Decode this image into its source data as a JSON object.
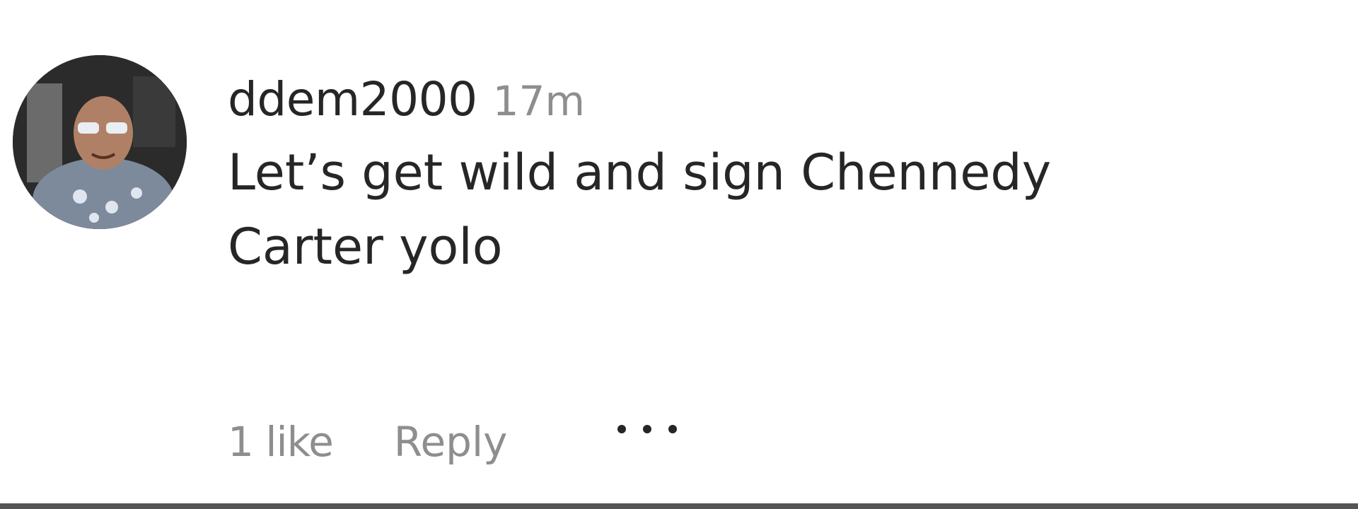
{
  "comment": {
    "username": "ddem2000",
    "timestamp": "17m",
    "text": "Let’s get wild and sign Chennedy\nCarter yolo",
    "likes": "1 like",
    "reply_label": "Reply",
    "more_icon": "more-options-icon",
    "avatar_icon": "avatar"
  },
  "colors": {
    "primary_text": "#262626",
    "secondary_text": "#8e8e8e",
    "background": "#ffffff"
  }
}
